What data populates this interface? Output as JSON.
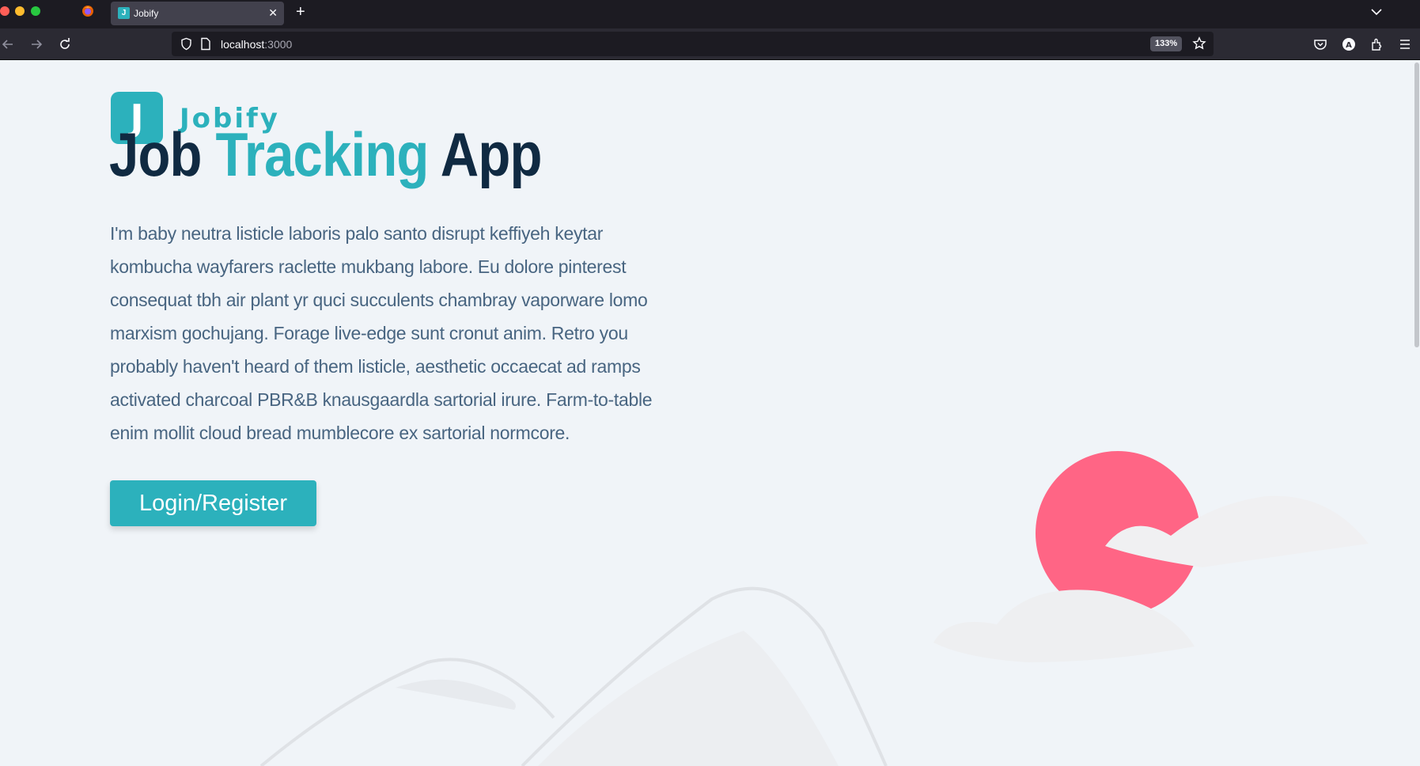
{
  "browser": {
    "tab_title": "Jobify",
    "tab_favicon_letter": "J",
    "url_host": "localhost",
    "url_port": ":3000",
    "zoom": "133%"
  },
  "page": {
    "logo_letter": "J",
    "logo_text": "Jobify",
    "title": {
      "part1": "Job",
      "part2": "Tracking",
      "part3": "App"
    },
    "description": "I'm baby neutra listicle laboris palo santo disrupt keffiyeh keytar kombucha wayfarers raclette mukbang labore. Eu dolore pinterest consequat tbh air plant yr quci succulents chambray vaporware lomo marxism gochujang. Forage live-edge sunt cronut anim. Retro you probably haven't heard of them listicle, aesthetic occaecat ad ramps activated charcoal PBR&B knausgaardla sartorial irure. Farm-to-table enim mollit cloud bread mumblecore ex sartorial normcore.",
    "cta_label": "Login/Register"
  },
  "colors": {
    "primary": "#2cb1bc",
    "heading": "#102a42",
    "text": "#486581",
    "background": "#f0f4f8",
    "sun": "#ff6585"
  },
  "icons": [
    "back-arrow-icon",
    "forward-arrow-icon",
    "reload-icon",
    "shield-icon",
    "page-icon",
    "star-icon",
    "pocket-icon",
    "account-icon",
    "extensions-icon",
    "menu-icon",
    "tab-list-chevron-icon",
    "firefox-icon"
  ]
}
